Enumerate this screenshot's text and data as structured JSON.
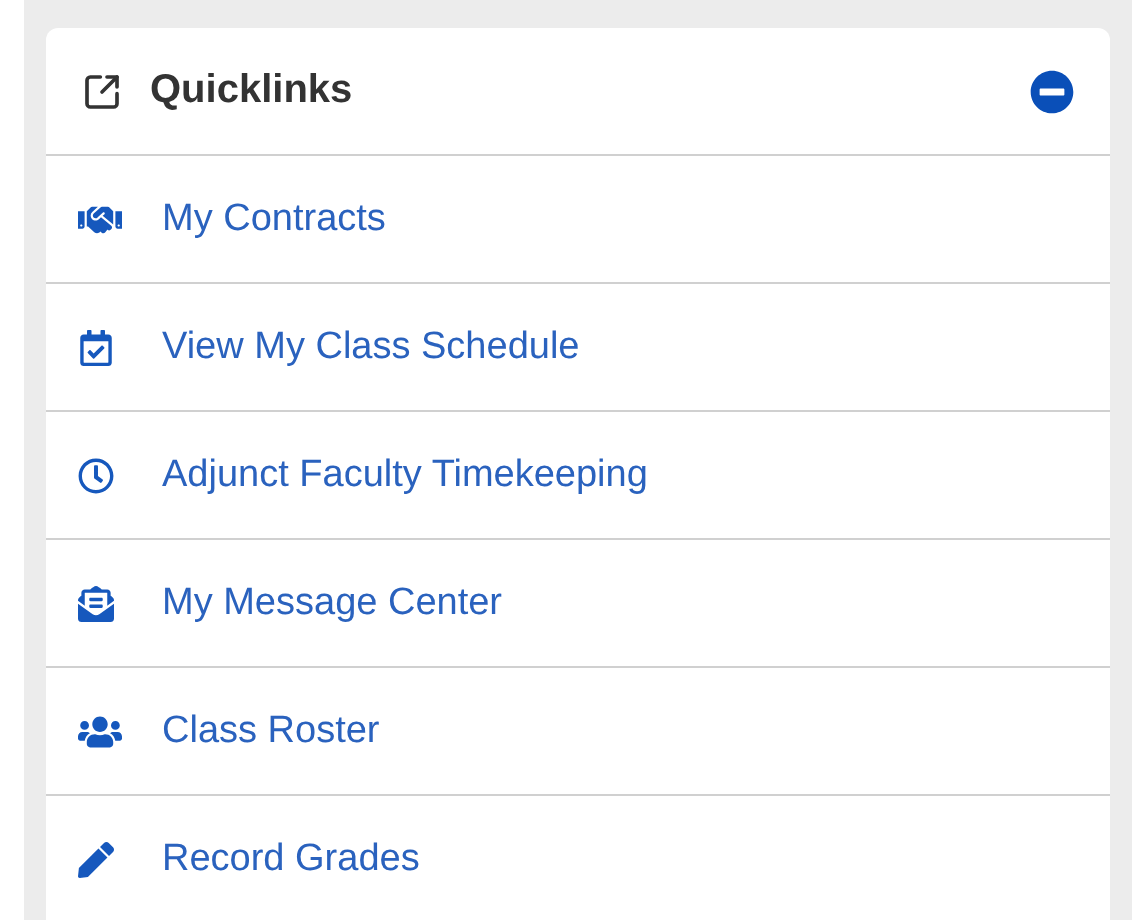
{
  "panel": {
    "title": "Quicklinks",
    "expanded": true
  },
  "links": [
    {
      "label": "My Contracts"
    },
    {
      "label": "View My Class Schedule"
    },
    {
      "label": "Adjunct Faculty Timekeeping"
    },
    {
      "label": "My Message Center"
    },
    {
      "label": "Class Roster"
    },
    {
      "label": "Record Grades"
    }
  ]
}
